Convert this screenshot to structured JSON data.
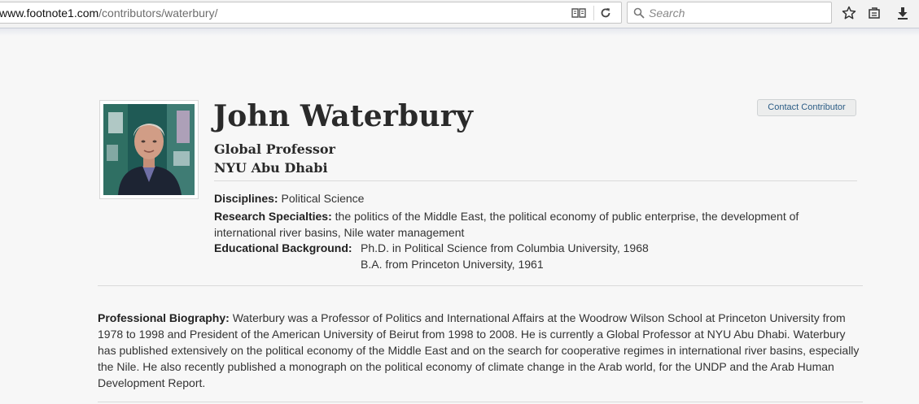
{
  "browser": {
    "url_domain": "www.footnote1.com",
    "url_path": "/contributors/waterbury/",
    "search_placeholder": "Search"
  },
  "profile": {
    "name": "John Waterbury",
    "title": "Global Professor",
    "institution": "NYU Abu Dhabi",
    "contact_label": "Contact Contributor",
    "disciplines_label": "Disciplines:",
    "disciplines": "Political Science",
    "research_label": "Research Specialties:",
    "research": "the politics of the Middle East, the political economy of public enterprise, the development of international river basins, Nile water management",
    "education_label": "Educational Background:",
    "education": [
      "Ph.D. in Political Science from Columbia University, 1968",
      "B.A. from Princeton University, 1961"
    ],
    "bio_label": "Professional Biography:",
    "bio": "Waterbury was a Professor of Politics and International Affairs at the Woodrow Wilson School at Princeton University from 1978 to 1998 and President of the American University of Beirut from 1998 to 2008. He is currently a Global Professor at NYU Abu Dhabi. Waterbury has published extensively on the political economy of the Middle East and on the search for cooperative regimes in international river basins, especially the Nile. He also recently published a monograph on the political economy of climate change in the Arab world, for the UNDP and the Arab Human Development Report."
  }
}
